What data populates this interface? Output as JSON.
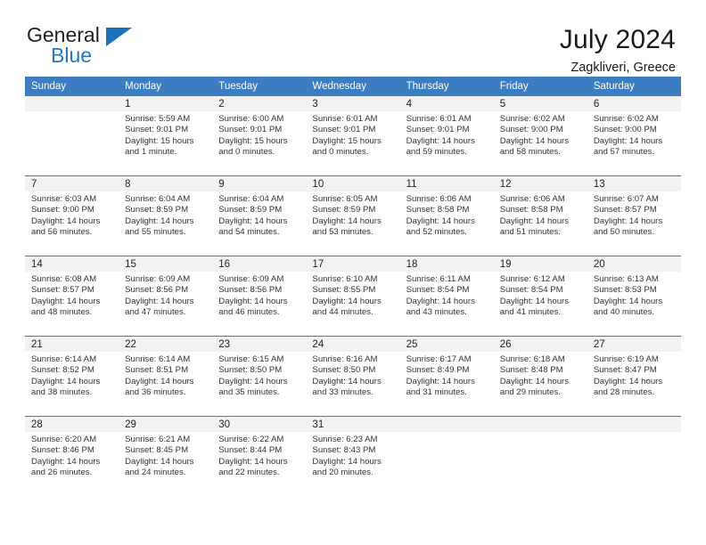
{
  "brand": {
    "name_top": "General",
    "name_bottom": "Blue",
    "accent_color": "#2079c4",
    "header_color": "#3b7dc0"
  },
  "header": {
    "title": "July 2024",
    "subtitle": "Zagkliveri, Greece"
  },
  "weekday_headers": [
    "Sunday",
    "Monday",
    "Tuesday",
    "Wednesday",
    "Thursday",
    "Friday",
    "Saturday"
  ],
  "weeks": [
    [
      {
        "day": "",
        "lines": []
      },
      {
        "day": "1",
        "lines": [
          "Sunrise: 5:59 AM",
          "Sunset: 9:01 PM",
          "Daylight: 15 hours",
          "and 1 minute."
        ]
      },
      {
        "day": "2",
        "lines": [
          "Sunrise: 6:00 AM",
          "Sunset: 9:01 PM",
          "Daylight: 15 hours",
          "and 0 minutes."
        ]
      },
      {
        "day": "3",
        "lines": [
          "Sunrise: 6:01 AM",
          "Sunset: 9:01 PM",
          "Daylight: 15 hours",
          "and 0 minutes."
        ]
      },
      {
        "day": "4",
        "lines": [
          "Sunrise: 6:01 AM",
          "Sunset: 9:01 PM",
          "Daylight: 14 hours",
          "and 59 minutes."
        ]
      },
      {
        "day": "5",
        "lines": [
          "Sunrise: 6:02 AM",
          "Sunset: 9:00 PM",
          "Daylight: 14 hours",
          "and 58 minutes."
        ]
      },
      {
        "day": "6",
        "lines": [
          "Sunrise: 6:02 AM",
          "Sunset: 9:00 PM",
          "Daylight: 14 hours",
          "and 57 minutes."
        ]
      }
    ],
    [
      {
        "day": "7",
        "lines": [
          "Sunrise: 6:03 AM",
          "Sunset: 9:00 PM",
          "Daylight: 14 hours",
          "and 56 minutes."
        ]
      },
      {
        "day": "8",
        "lines": [
          "Sunrise: 6:04 AM",
          "Sunset: 8:59 PM",
          "Daylight: 14 hours",
          "and 55 minutes."
        ]
      },
      {
        "day": "9",
        "lines": [
          "Sunrise: 6:04 AM",
          "Sunset: 8:59 PM",
          "Daylight: 14 hours",
          "and 54 minutes."
        ]
      },
      {
        "day": "10",
        "lines": [
          "Sunrise: 6:05 AM",
          "Sunset: 8:59 PM",
          "Daylight: 14 hours",
          "and 53 minutes."
        ]
      },
      {
        "day": "11",
        "lines": [
          "Sunrise: 6:06 AM",
          "Sunset: 8:58 PM",
          "Daylight: 14 hours",
          "and 52 minutes."
        ]
      },
      {
        "day": "12",
        "lines": [
          "Sunrise: 6:06 AM",
          "Sunset: 8:58 PM",
          "Daylight: 14 hours",
          "and 51 minutes."
        ]
      },
      {
        "day": "13",
        "lines": [
          "Sunrise: 6:07 AM",
          "Sunset: 8:57 PM",
          "Daylight: 14 hours",
          "and 50 minutes."
        ]
      }
    ],
    [
      {
        "day": "14",
        "lines": [
          "Sunrise: 6:08 AM",
          "Sunset: 8:57 PM",
          "Daylight: 14 hours",
          "and 48 minutes."
        ]
      },
      {
        "day": "15",
        "lines": [
          "Sunrise: 6:09 AM",
          "Sunset: 8:56 PM",
          "Daylight: 14 hours",
          "and 47 minutes."
        ]
      },
      {
        "day": "16",
        "lines": [
          "Sunrise: 6:09 AM",
          "Sunset: 8:56 PM",
          "Daylight: 14 hours",
          "and 46 minutes."
        ]
      },
      {
        "day": "17",
        "lines": [
          "Sunrise: 6:10 AM",
          "Sunset: 8:55 PM",
          "Daylight: 14 hours",
          "and 44 minutes."
        ]
      },
      {
        "day": "18",
        "lines": [
          "Sunrise: 6:11 AM",
          "Sunset: 8:54 PM",
          "Daylight: 14 hours",
          "and 43 minutes."
        ]
      },
      {
        "day": "19",
        "lines": [
          "Sunrise: 6:12 AM",
          "Sunset: 8:54 PM",
          "Daylight: 14 hours",
          "and 41 minutes."
        ]
      },
      {
        "day": "20",
        "lines": [
          "Sunrise: 6:13 AM",
          "Sunset: 8:53 PM",
          "Daylight: 14 hours",
          "and 40 minutes."
        ]
      }
    ],
    [
      {
        "day": "21",
        "lines": [
          "Sunrise: 6:14 AM",
          "Sunset: 8:52 PM",
          "Daylight: 14 hours",
          "and 38 minutes."
        ]
      },
      {
        "day": "22",
        "lines": [
          "Sunrise: 6:14 AM",
          "Sunset: 8:51 PM",
          "Daylight: 14 hours",
          "and 36 minutes."
        ]
      },
      {
        "day": "23",
        "lines": [
          "Sunrise: 6:15 AM",
          "Sunset: 8:50 PM",
          "Daylight: 14 hours",
          "and 35 minutes."
        ]
      },
      {
        "day": "24",
        "lines": [
          "Sunrise: 6:16 AM",
          "Sunset: 8:50 PM",
          "Daylight: 14 hours",
          "and 33 minutes."
        ]
      },
      {
        "day": "25",
        "lines": [
          "Sunrise: 6:17 AM",
          "Sunset: 8:49 PM",
          "Daylight: 14 hours",
          "and 31 minutes."
        ]
      },
      {
        "day": "26",
        "lines": [
          "Sunrise: 6:18 AM",
          "Sunset: 8:48 PM",
          "Daylight: 14 hours",
          "and 29 minutes."
        ]
      },
      {
        "day": "27",
        "lines": [
          "Sunrise: 6:19 AM",
          "Sunset: 8:47 PM",
          "Daylight: 14 hours",
          "and 28 minutes."
        ]
      }
    ],
    [
      {
        "day": "28",
        "lines": [
          "Sunrise: 6:20 AM",
          "Sunset: 8:46 PM",
          "Daylight: 14 hours",
          "and 26 minutes."
        ]
      },
      {
        "day": "29",
        "lines": [
          "Sunrise: 6:21 AM",
          "Sunset: 8:45 PM",
          "Daylight: 14 hours",
          "and 24 minutes."
        ]
      },
      {
        "day": "30",
        "lines": [
          "Sunrise: 6:22 AM",
          "Sunset: 8:44 PM",
          "Daylight: 14 hours",
          "and 22 minutes."
        ]
      },
      {
        "day": "31",
        "lines": [
          "Sunrise: 6:23 AM",
          "Sunset: 8:43 PM",
          "Daylight: 14 hours",
          "and 20 minutes."
        ]
      },
      {
        "day": "",
        "lines": []
      },
      {
        "day": "",
        "lines": []
      },
      {
        "day": "",
        "lines": []
      }
    ]
  ]
}
